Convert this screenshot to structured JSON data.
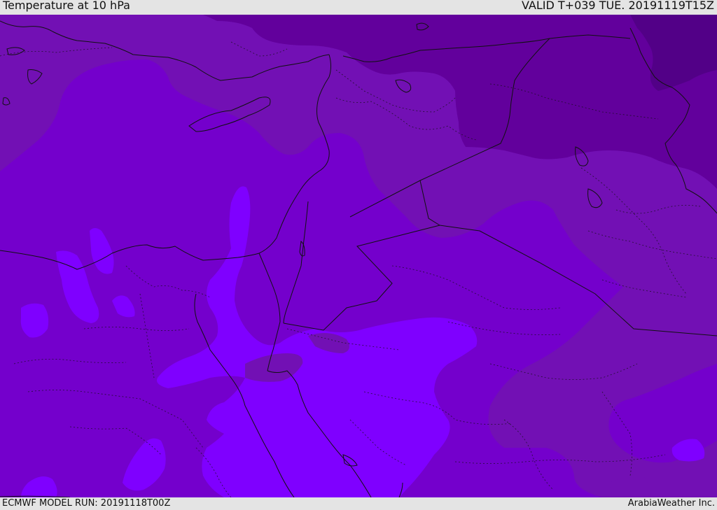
{
  "header": {
    "title": "Temperature at 10 hPa",
    "valid_time": "VALID T+039 TUE. 20191119T15Z"
  },
  "footer": {
    "model_run": "ECMWF MODEL RUN: 20191118T00Z",
    "credit": "ArabiaWeather Inc."
  },
  "map": {
    "field": "temperature",
    "level": "10 hPa",
    "colors": {
      "band_coldest": "#520087",
      "band_cold": "#62009c",
      "band_cool": "#7210b4",
      "band_mid": "#7400cc",
      "band_warm": "#7f00ff",
      "boundary": "#111111"
    }
  }
}
